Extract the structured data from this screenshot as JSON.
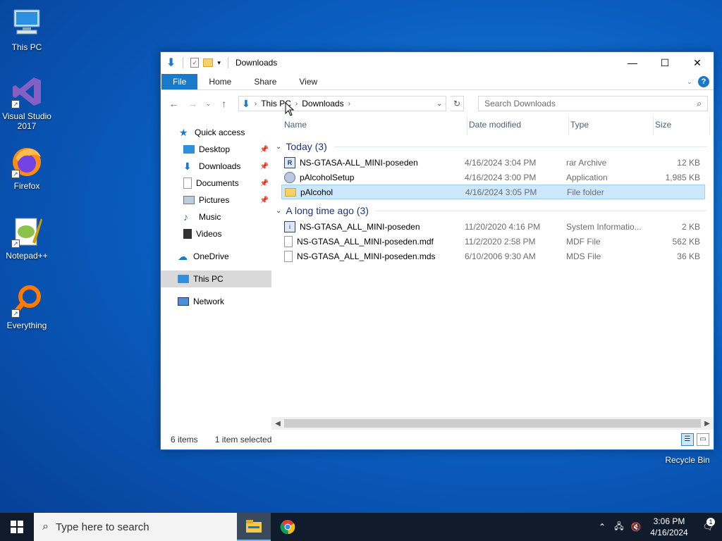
{
  "desktop": {
    "icons": [
      {
        "label": "This PC"
      },
      {
        "label": "Visual Studio 2017"
      },
      {
        "label": "Firefox"
      },
      {
        "label": "Notepad++"
      },
      {
        "label": "Everything"
      },
      {
        "label": "Recycle Bin"
      }
    ]
  },
  "window": {
    "title": "Downloads",
    "ribbon_tabs": [
      "File",
      "Home",
      "Share",
      "View"
    ],
    "breadcrumb": [
      "This PC",
      "Downloads"
    ],
    "search_placeholder": "Search Downloads",
    "nav": {
      "quick_access": "Quick access",
      "items": [
        "Desktop",
        "Downloads",
        "Documents",
        "Pictures",
        "Music",
        "Videos"
      ],
      "onedrive": "OneDrive",
      "this_pc": "This PC",
      "network": "Network"
    },
    "columns": {
      "name": "Name",
      "date": "Date modified",
      "type": "Type",
      "size": "Size"
    },
    "groups": [
      {
        "label": "Today (3)",
        "rows": [
          {
            "name": "NS-GTASA-ALL_MINI-poseden",
            "date": "4/16/2024 3:04 PM",
            "type": "rar Archive",
            "size": "12 KB"
          },
          {
            "name": "pAlcoholSetup",
            "date": "4/16/2024 3:00 PM",
            "type": "Application",
            "size": "1,985 KB"
          },
          {
            "name": "pAlcohol",
            "date": "4/16/2024 3:05 PM",
            "type": "File folder",
            "size": ""
          }
        ]
      },
      {
        "label": "A long time ago (3)",
        "rows": [
          {
            "name": "NS-GTASA_ALL_MINI-poseden",
            "date": "11/20/2020 4:16 PM",
            "type": "System Informatio...",
            "size": "2 KB"
          },
          {
            "name": "NS-GTASA_ALL_MINI-poseden.mdf",
            "date": "11/2/2020 2:58 PM",
            "type": "MDF File",
            "size": "562 KB"
          },
          {
            "name": "NS-GTASA_ALL_MINI-poseden.mds",
            "date": "6/10/2006 9:30 AM",
            "type": "MDS File",
            "size": "36 KB"
          }
        ]
      }
    ],
    "status": {
      "items": "6 items",
      "selected": "1 item selected"
    }
  },
  "taskbar": {
    "search_placeholder": "Type here to search",
    "time": "3:06 PM",
    "date": "4/16/2024",
    "notification_count": "1"
  },
  "colors": {
    "accent": "#1979ca",
    "selection": "#cce8ff",
    "taskbar": "#101c2c"
  }
}
